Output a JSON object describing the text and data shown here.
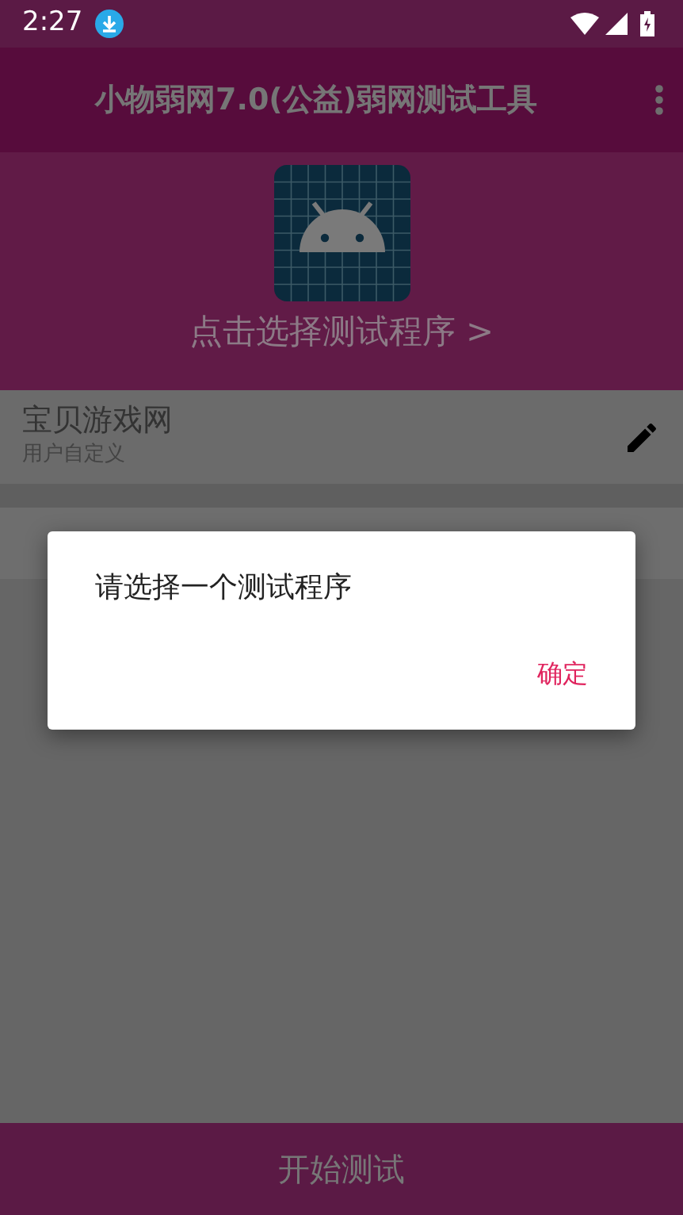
{
  "status_bar": {
    "time": "2:27"
  },
  "app_bar": {
    "title": "小物弱网7.0(公益)弱网测试工具"
  },
  "program_picker": {
    "label": "点击选择测试程序 >"
  },
  "profile": {
    "title": "宝贝游戏网",
    "subtitle": "用户自定义"
  },
  "dialog": {
    "message": "请选择一个测试程序",
    "buttons": [
      "确定"
    ]
  },
  "bottom_button": {
    "label": "开始测试"
  }
}
